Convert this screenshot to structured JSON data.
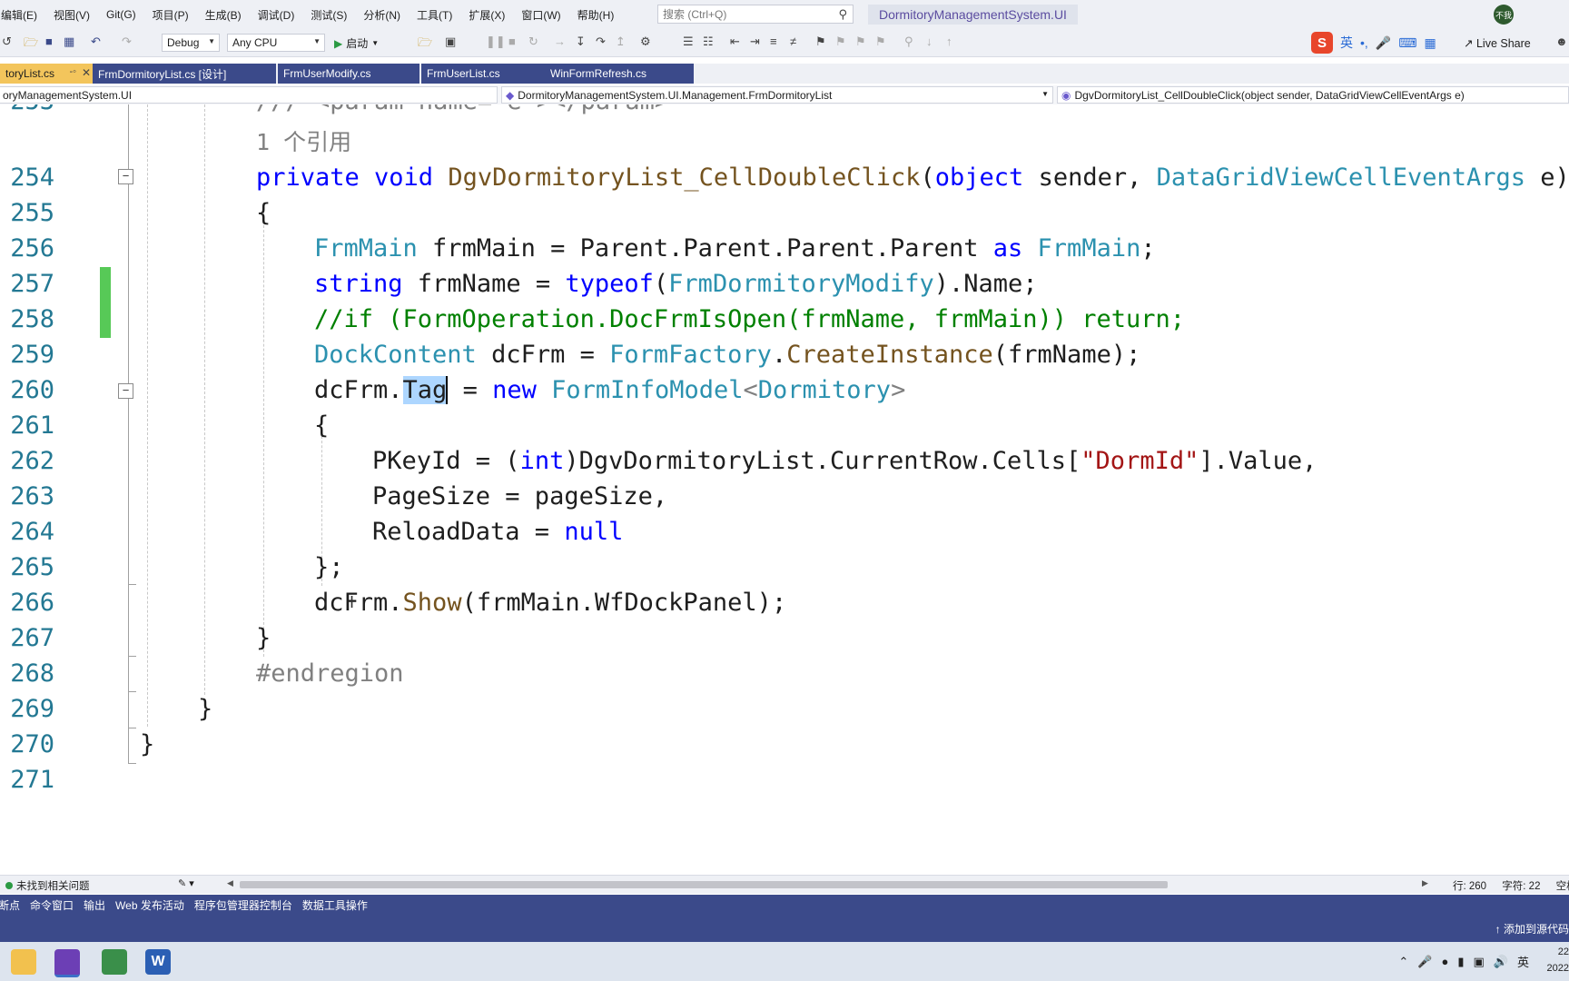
{
  "menubar": {
    "items": [
      "编辑(E)",
      "视图(V)",
      "Git(G)",
      "项目(P)",
      "生成(B)",
      "调试(D)",
      "测试(S)",
      "分析(N)",
      "工具(T)",
      "扩展(X)",
      "窗口(W)",
      "帮助(H)"
    ],
    "search_placeholder": "搜索 (Ctrl+Q)",
    "solution_title": "DormitoryManagementSystem.UI",
    "avatar_text": "不我"
  },
  "toolbar": {
    "config": "Debug",
    "platform": "Any CPU",
    "start_label": "启动",
    "ime_lang": "英",
    "live_share": "Live Share"
  },
  "tabs": [
    {
      "label": "toryList.cs",
      "active": true
    },
    {
      "label": "FrmDormitoryList.cs [设计]",
      "active": false
    },
    {
      "label": "FrmUserModify.cs",
      "active": false
    },
    {
      "label": "FrmUserList.cs",
      "active": false
    },
    {
      "label": "WinFormRefresh.cs",
      "active": false
    }
  ],
  "navbar": {
    "project": "oryManagementSystem.UI",
    "class": "DormitoryManagementSystem.UI.Management.FrmDormitoryList",
    "member": "DgvDormitoryList_CellDoubleClick(object sender, DataGridViewCellEventArgs e)"
  },
  "editor": {
    "line_numbers": [
      "253",
      "254",
      "255",
      "256",
      "257",
      "258",
      "259",
      "260",
      "261",
      "262",
      "263",
      "264",
      "265",
      "266",
      "267",
      "268",
      "269",
      "270",
      "271"
    ],
    "partial_top": "/// <param name=\"e\"></param>",
    "ref_count": "1 个引用",
    "lines": {
      "l254_a": "private void ",
      "l254_b": "DgvDormitoryList_CellDoubleClick",
      "l254_c": "(",
      "l254_d": "object",
      "l254_e": " sender, ",
      "l254_f": "DataGridViewCellEventArgs",
      "l254_g": " e)",
      "l255": "{",
      "l256_a": "FrmMain",
      "l256_b": " frmMain = Parent.Parent.Parent.Parent ",
      "l256_c": "as",
      "l256_d": " ",
      "l256_e": "FrmMain",
      "l256_f": ";",
      "l257_a": "string",
      "l257_b": " frmName = ",
      "l257_c": "typeof",
      "l257_d": "(",
      "l257_e": "FrmDormitoryModify",
      "l257_f": ").Name;",
      "l258": "//if (FormOperation.DocFrmIsOpen(frmName, frmMain)) return;",
      "l259_a": "DockContent",
      "l259_b": " dcFrm = ",
      "l259_c": "FormFactory",
      "l259_d": ".",
      "l259_e": "CreateInstance",
      "l259_f": "(frmName);",
      "l260_a": "dcFrm.",
      "l260_b": "Tag",
      "l260_c": " = ",
      "l260_d": "new",
      "l260_e": " ",
      "l260_f": "FormInfoModel",
      "l260_g": "<",
      "l260_h": "Dormitory",
      "l260_i": ">",
      "l261": "{",
      "l262_a": "PKeyId = (",
      "l262_b": "int",
      "l262_c": ")DgvDormitoryList.CurrentRow.Cells[",
      "l262_d": "\"DormId\"",
      "l262_e": "].Value,",
      "l263": "PageSize = pageSize,",
      "l264_a": "ReloadData = ",
      "l264_b": "null",
      "l265": "};",
      "l266_a": "dcFrm.",
      "l266_b": "Show",
      "l266_c": "(frmMain.WfDockPanel);",
      "l267": "}",
      "l268": "#endregion",
      "l269": "}",
      "l270": "}"
    }
  },
  "status": {
    "issues": "未找到相关问题",
    "line": "行: 260",
    "col": "字符: 22",
    "extra": "空格"
  },
  "tooltabs": [
    "断点",
    "命令窗口",
    "输出",
    "Web 发布活动",
    "程序包管理器控制台",
    "数据工具操作"
  ],
  "source_control": "↑ 添加到源代码",
  "taskbar": {
    "tray_lang": "英",
    "clock_time": "22",
    "clock_date": "2022"
  },
  "colors": {
    "accent": "#3b4a8a",
    "active_tab": "#f3c55c",
    "keyword": "#0000ff",
    "type": "#2b91af",
    "method": "#74531f",
    "comment": "#008000",
    "string": "#a31515",
    "change_marker": "#57c957"
  }
}
